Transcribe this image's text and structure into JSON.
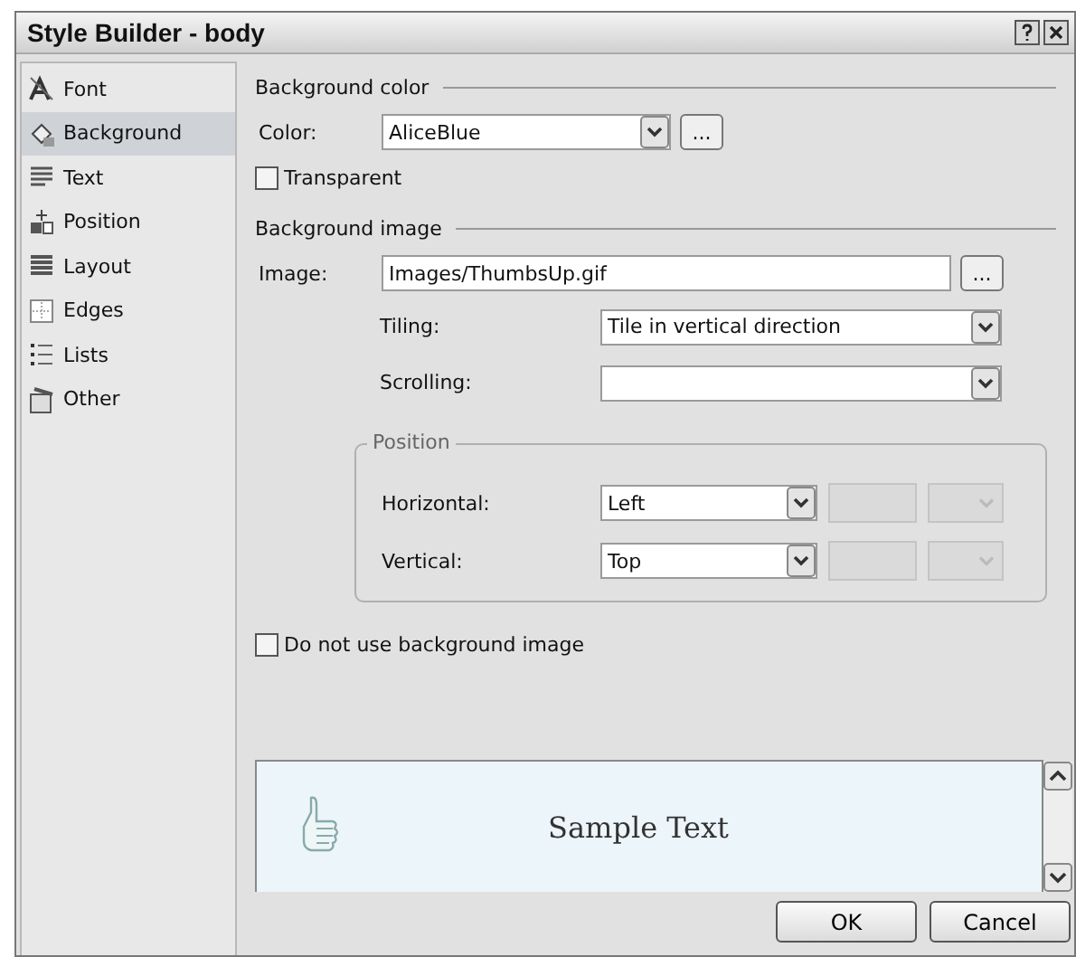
{
  "window": {
    "title": "Style Builder - body"
  },
  "sidebar": {
    "items": [
      {
        "label": "Font",
        "kind": "font",
        "selected": false
      },
      {
        "label": "Background",
        "kind": "background",
        "selected": true
      },
      {
        "label": "Text",
        "kind": "text",
        "selected": false
      },
      {
        "label": "Position",
        "kind": "position",
        "selected": false
      },
      {
        "label": "Layout",
        "kind": "layout",
        "selected": false
      },
      {
        "label": "Edges",
        "kind": "edges",
        "selected": false
      },
      {
        "label": "Lists",
        "kind": "lists",
        "selected": false
      },
      {
        "label": "Other",
        "kind": "other",
        "selected": false
      }
    ]
  },
  "background_color": {
    "heading": "Background color",
    "color_label": "Color:",
    "color_value": "AliceBlue",
    "browse": "...",
    "transparent": {
      "label": "Transparent",
      "checked": false
    }
  },
  "background_image": {
    "heading": "Background image",
    "image_label": "Image:",
    "image_value": "Images/ThumbsUp.gif",
    "browse": "...",
    "tiling_label": "Tiling:",
    "tiling_value": "Tile in vertical direction",
    "scrolling_label": "Scrolling:",
    "position": {
      "title": "Position",
      "rows": [
        {
          "label": "Horizontal:",
          "value": "Left"
        },
        {
          "label": "Vertical:",
          "value": "Top"
        }
      ]
    },
    "do_not_use": {
      "label": "Do not use background image",
      "checked": false
    }
  },
  "preview": {
    "sample_text": "Sample Text"
  },
  "buttons": [
    "OK",
    "Cancel"
  ]
}
